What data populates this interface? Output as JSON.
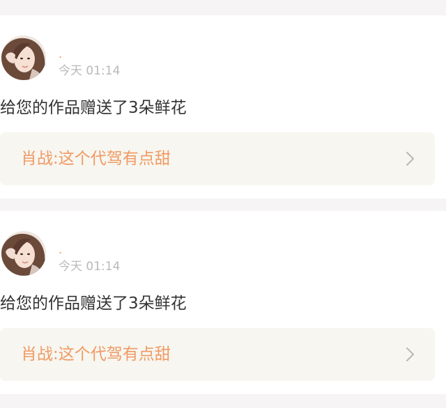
{
  "feed": {
    "items": [
      {
        "username": ".",
        "time": "今天 01:14",
        "message": "给您的作品赠送了3朵鲜花",
        "work_title": "肖战:这个代驾有点甜",
        "icons": {
          "avatar": "avatar",
          "chevron": "chevron-right-icon"
        }
      },
      {
        "username": ".",
        "time": "今天 01:14",
        "message": "给您的作品赠送了3朵鲜花",
        "work_title": "肖战:这个代驾有点甜",
        "icons": {
          "avatar": "avatar",
          "chevron": "chevron-right-icon"
        }
      }
    ]
  },
  "colors": {
    "background": "#f7f4f5",
    "card": "#ffffff",
    "accent": "#f09a63",
    "time": "#b9b9b9",
    "message": "#333333",
    "link_bg": "#f7f6f0"
  }
}
